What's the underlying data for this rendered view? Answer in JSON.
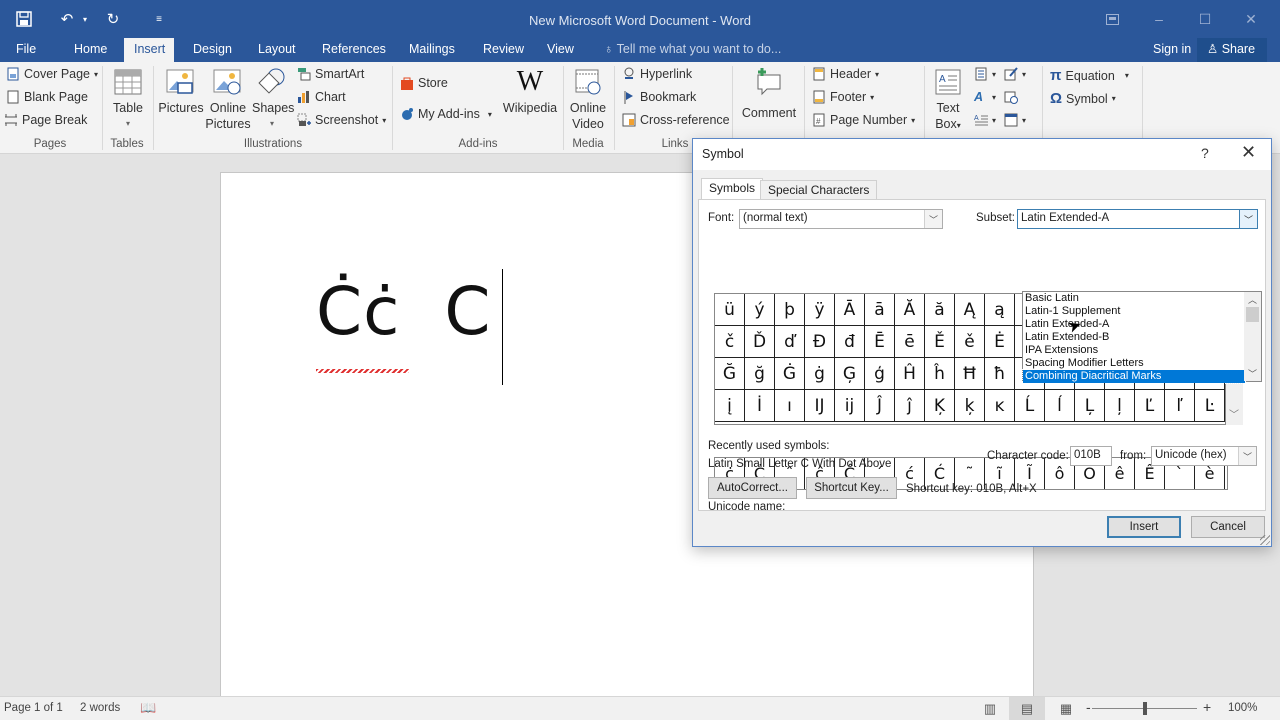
{
  "window": {
    "title": "New Microsoft Word Document - Word",
    "qat": {
      "save_icon": "save-icon",
      "undo_icon": "undo-icon",
      "redo_icon": "repeat-icon",
      "customize_icon": "customize-qat-icon"
    },
    "controls": {
      "ribbon_display": "ribbon-display-icon",
      "minimize": "–",
      "maximize": "☐",
      "close": "✕"
    }
  },
  "tabs": {
    "items": [
      "File",
      "Home",
      "Insert",
      "Design",
      "Layout",
      "References",
      "Mailings",
      "Review",
      "View"
    ],
    "active": "Insert",
    "tell_me": "Tell me what you want to do...",
    "sign_in": "Sign in",
    "share": "Share"
  },
  "ribbon": {
    "pages": {
      "label": "Pages",
      "cover_page": "Cover Page",
      "blank_page": "Blank Page",
      "page_break": "Page Break"
    },
    "tables": {
      "label": "Tables",
      "table": "Table"
    },
    "illustrations": {
      "label": "Illustrations",
      "pictures": "Pictures",
      "online_pictures_1": "Online",
      "online_pictures_2": "Pictures",
      "shapes": "Shapes",
      "smartart": "SmartArt",
      "chart": "Chart",
      "screenshot": "Screenshot"
    },
    "addins": {
      "label": "Add-ins",
      "store": "Store",
      "my_addins": "My Add-ins",
      "wikipedia": "Wikipedia"
    },
    "media": {
      "label": "Media",
      "online_video_1": "Online",
      "online_video_2": "Video"
    },
    "links": {
      "label": "Links",
      "hyperlink": "Hyperlink",
      "bookmark": "Bookmark",
      "cross_reference": "Cross-reference"
    },
    "comments": {
      "comment": "Comment"
    },
    "header_footer": {
      "header": "Header",
      "footer": "Footer",
      "page_number": "Page Number"
    },
    "text": {
      "text_box_1": "Text",
      "text_box_2": "Box"
    },
    "symbols": {
      "equation": "Equation",
      "symbol": "Symbol"
    }
  },
  "document": {
    "text": "Ċċ  C"
  },
  "status": {
    "page": "Page 1 of 1",
    "words": "2 words",
    "zoom": "100%",
    "zoom_value_percent": 100
  },
  "dialog": {
    "title": "Symbol",
    "help": "?",
    "close": "✕",
    "tabs": [
      "Symbols",
      "Special Characters"
    ],
    "active_tab": "Symbols",
    "font_label": "Font:",
    "font_value": "(normal text)",
    "subset_label": "Subset:",
    "subset_value": "Latin Extended-A",
    "subset_options": [
      "Basic Latin",
      "Latin-1 Supplement",
      "Latin Extended-A",
      "Latin Extended-B",
      "IPA Extensions",
      "Spacing Modifier Letters",
      "Combining Diacritical Marks"
    ],
    "subset_highlighted": "Combining Diacritical Marks",
    "grid_rows": [
      [
        "ü",
        "ý",
        "þ",
        "ÿ",
        "Ā",
        "ā",
        "Ă",
        "ă",
        "Ą",
        "ą",
        "",
        "",
        "",
        "",
        "",
        "",
        ""
      ],
      [
        "č",
        "Ď",
        "ď",
        "Đ",
        "đ",
        "Ē",
        "ē",
        "Ě",
        "ě",
        "Ė",
        "",
        "",
        "",
        "",
        "",
        "",
        ""
      ],
      [
        "Ğ",
        "ğ",
        "Ġ",
        "ġ",
        "Ģ",
        "ģ",
        "Ĥ",
        "ĥ",
        "Ħ",
        "ħ",
        "",
        "",
        "",
        "",
        "",
        "",
        ""
      ],
      [
        "į",
        "İ",
        "ı",
        "Ĳ",
        "ĳ",
        "Ĵ",
        "ĵ",
        "Ķ",
        "ķ",
        "ĸ",
        "Ĺ",
        "ĺ",
        "Ļ",
        "ļ",
        "Ľ",
        "ľ",
        "Ŀ"
      ]
    ],
    "recent_label": "Recently used symbols:",
    "recent": [
      "ċ",
      "Ċ",
      "ˆ",
      "ĉ",
      "Ĉ",
      "ˊ",
      "ć",
      "Ć",
      "˜",
      "ĩ",
      "Ĩ",
      "ô",
      "Ô",
      "ê",
      "Ê",
      "ˋ",
      "è"
    ],
    "unicode_name_label": "Unicode name:",
    "unicode_name": "Latin Small Letter C With Dot Above",
    "char_code_label": "Character code:",
    "char_code": "010B",
    "from_label": "from:",
    "from_value": "Unicode (hex)",
    "autocorrect": "AutoCorrect...",
    "shortcut_key_btn": "Shortcut Key...",
    "shortcut_key_text": "Shortcut key: 010B, Alt+X",
    "insert": "Insert",
    "cancel": "Cancel"
  }
}
